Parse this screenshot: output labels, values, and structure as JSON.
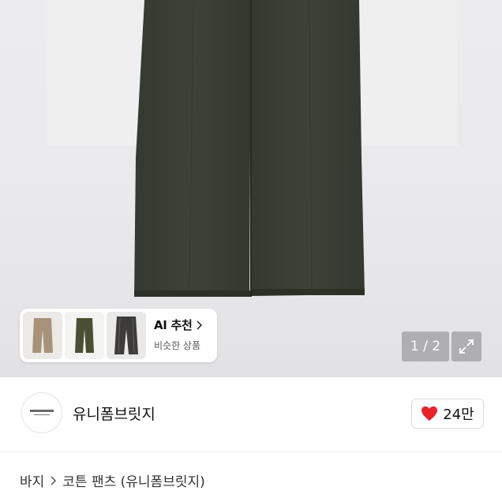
{
  "gallery": {
    "counter": "1 / 2",
    "colors": {
      "pants": "#3a4035",
      "pants_shade": "#2f352b",
      "background": "#e9e9eb"
    }
  },
  "ai_recommend": {
    "title": "AI 추천",
    "subtitle": "비슷한 상품",
    "thumbnails": [
      {
        "name": "beige-pants",
        "color": "#a9927a"
      },
      {
        "name": "olive-pants",
        "color": "#4a4f33"
      },
      {
        "name": "charcoal-pants",
        "color": "#3e3c3a"
      }
    ]
  },
  "shop": {
    "name": "유니폼브릿지",
    "likes": "24만",
    "heart_color": "#e8232b"
  },
  "breadcrumb": {
    "items": [
      "바지",
      "코튼 팬츠 (유니폼브릿지)"
    ]
  }
}
